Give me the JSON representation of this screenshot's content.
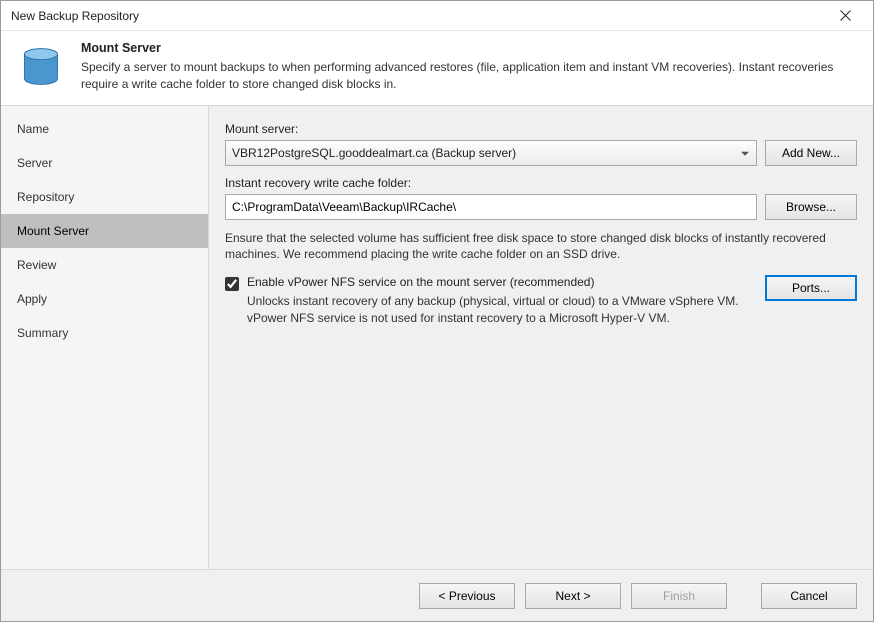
{
  "window": {
    "title": "New Backup Repository"
  },
  "header": {
    "title": "Mount Server",
    "description": "Specify a server to mount backups to when performing advanced restores (file, application item and instant VM recoveries). Instant recoveries require a write cache folder to store changed disk blocks in."
  },
  "sidebar": {
    "items": [
      {
        "label": "Name"
      },
      {
        "label": "Server"
      },
      {
        "label": "Repository"
      },
      {
        "label": "Mount Server",
        "active": true
      },
      {
        "label": "Review"
      },
      {
        "label": "Apply"
      },
      {
        "label": "Summary"
      }
    ]
  },
  "main": {
    "mount_server_label": "Mount server:",
    "mount_server_value": "VBR12PostgreSQL.gooddealmart.ca (Backup server)",
    "add_new_label": "Add New...",
    "cache_label": "Instant recovery write cache folder:",
    "cache_value": "C:\\ProgramData\\Veeam\\Backup\\IRCache\\",
    "browse_label": "Browse...",
    "cache_hint": "Ensure that the selected volume has sufficient free disk space to store changed disk blocks of instantly recovered machines. We recommend placing the write cache folder on an SSD drive.",
    "vpower_checked": true,
    "vpower_label": "Enable vPower NFS service on the mount server (recommended)",
    "vpower_desc": "Unlocks instant recovery of any backup (physical, virtual or cloud) to a VMware vSphere VM. vPower NFS service is not used for instant recovery to a Microsoft Hyper-V VM.",
    "ports_label": "Ports..."
  },
  "footer": {
    "previous": "< Previous",
    "next": "Next >",
    "finish": "Finish",
    "cancel": "Cancel",
    "finish_enabled": false
  }
}
